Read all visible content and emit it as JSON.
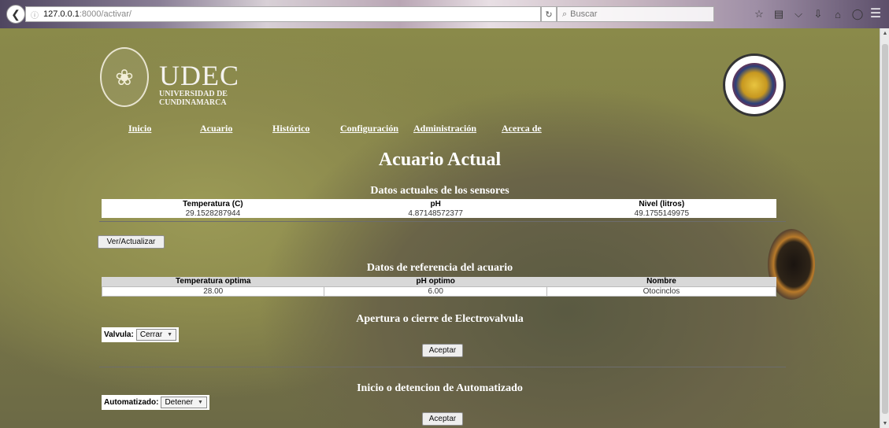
{
  "browser": {
    "url_host": "127.0.0.1",
    "url_path": ":8000/activar/",
    "search_placeholder": "Buscar"
  },
  "header": {
    "brand_name": "UDEC",
    "brand_sub_1": "UNIVERSIDAD DE",
    "brand_sub_2": "CUNDINAMARCA"
  },
  "nav": [
    {
      "label": "Inicio"
    },
    {
      "label": "Acuario"
    },
    {
      "label": "Histórico"
    },
    {
      "label": "Configuración"
    },
    {
      "label": "Administración"
    },
    {
      "label": "Acerca de"
    }
  ],
  "page_title": "Acuario Actual",
  "sensors": {
    "title": "Datos actuales de los sensores",
    "headers": [
      "Temperatura (C)",
      "pH",
      "Nivel (litros)"
    ],
    "values": [
      "29.1528287944",
      "4.87148572377",
      "49.1755149975"
    ],
    "button": "Ver/Actualizar"
  },
  "reference": {
    "title": "Datos de referencia del acuario",
    "headers": [
      "Temperatura optima",
      "pH optimo",
      "Nombre"
    ],
    "values": [
      "28.00",
      "6.00",
      "Otocinclos"
    ]
  },
  "valve": {
    "title": "Apertura o cierre de Electrovalvula",
    "label": "Valvula:",
    "selected": "Cerrar",
    "button": "Aceptar"
  },
  "automation": {
    "title": "Inicio o detencion de Automatizado",
    "label": "Automatizado:",
    "selected": "Detener",
    "button": "Aceptar"
  },
  "colors": {
    "nav_text": "#ffffff",
    "title_text": "#ffffff"
  }
}
